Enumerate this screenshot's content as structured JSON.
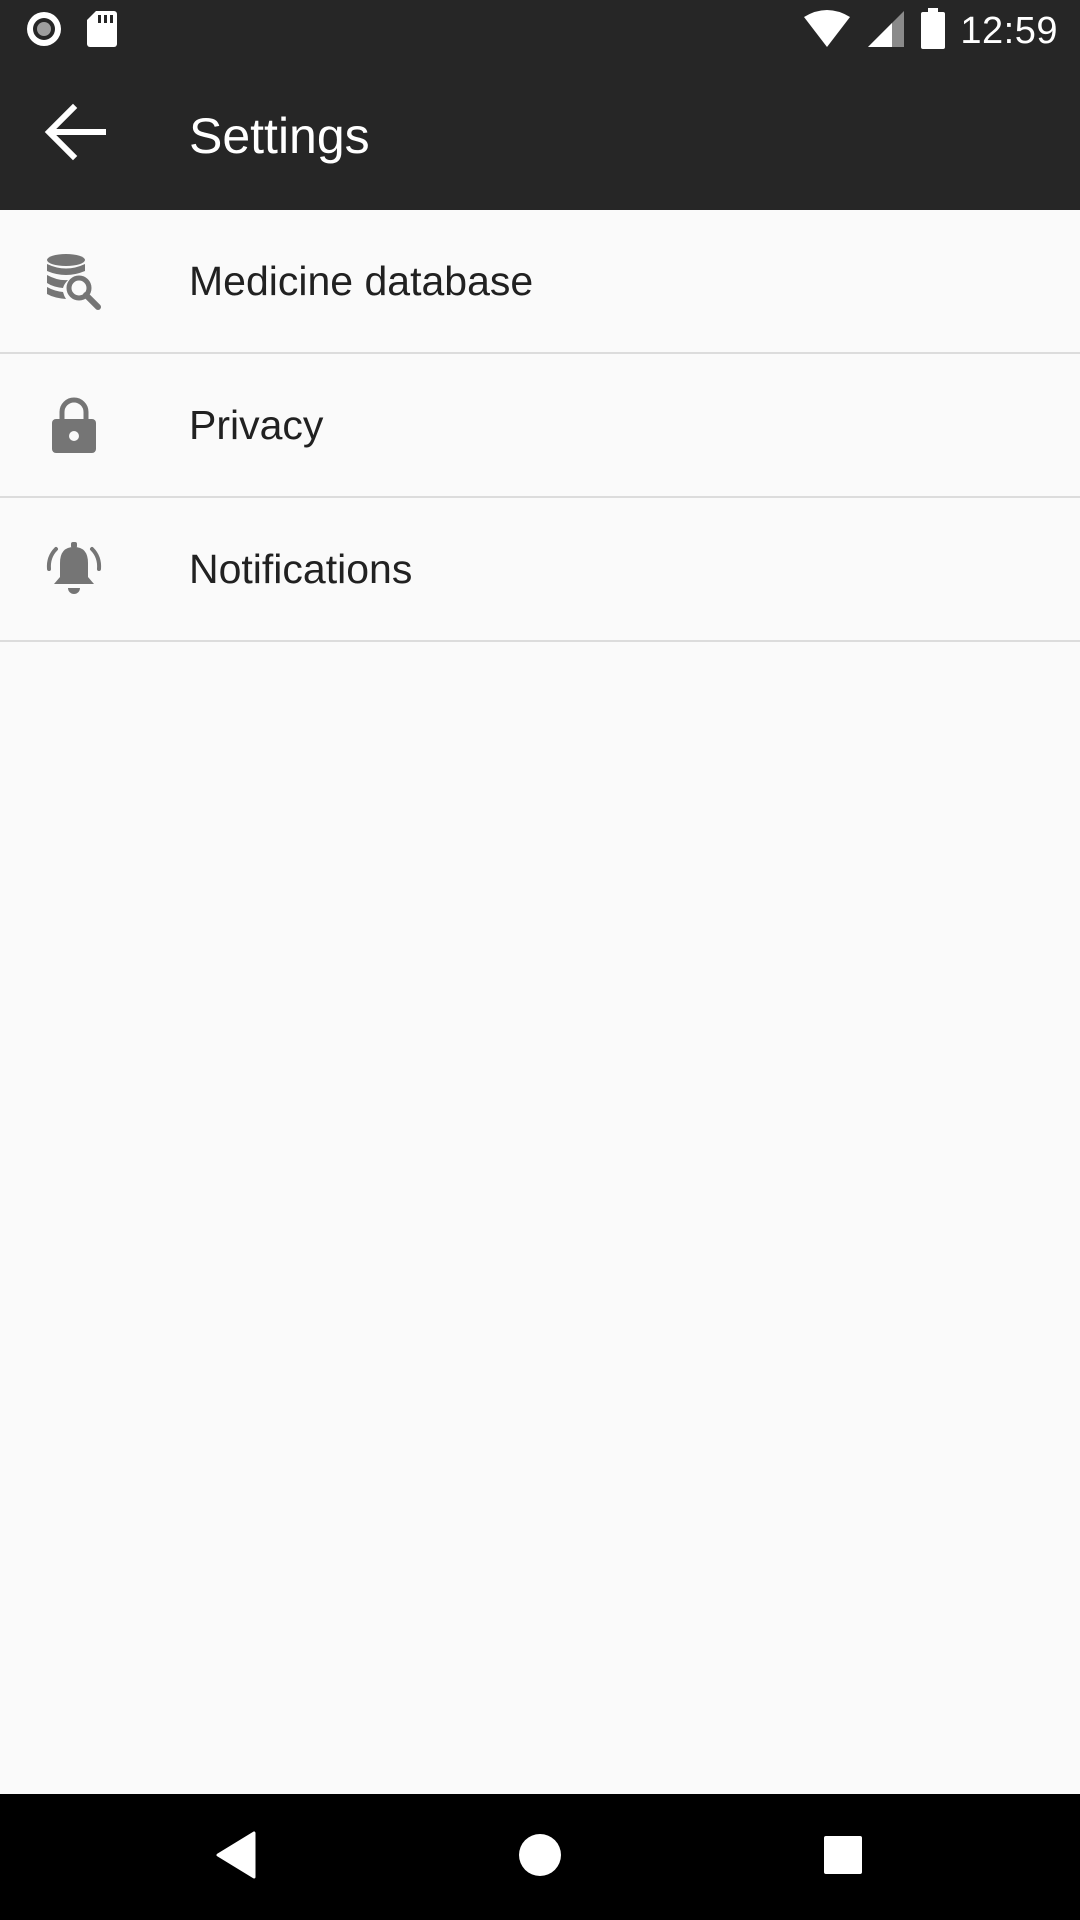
{
  "status_bar": {
    "time": "12:59",
    "left_icons": [
      "record-icon",
      "sd-card-icon"
    ],
    "right_icons": [
      "wifi-icon",
      "signal-icon",
      "battery-icon"
    ]
  },
  "app_bar": {
    "title": "Settings",
    "back_icon": "arrow-back-icon"
  },
  "settings": {
    "items": [
      {
        "label": "Medicine database",
        "icon": "database-search-icon"
      },
      {
        "label": "Privacy",
        "icon": "lock-icon"
      },
      {
        "label": "Notifications",
        "icon": "alarm-bell-icon"
      }
    ]
  },
  "nav_bar": {
    "buttons": [
      "back-triangle-icon",
      "home-circle-icon",
      "recents-square-icon"
    ]
  },
  "colors": {
    "app_bar": "#262626",
    "background": "#fafafa",
    "icon_gray": "#757575",
    "text": "#212121",
    "divider": "#dcdcdc"
  }
}
